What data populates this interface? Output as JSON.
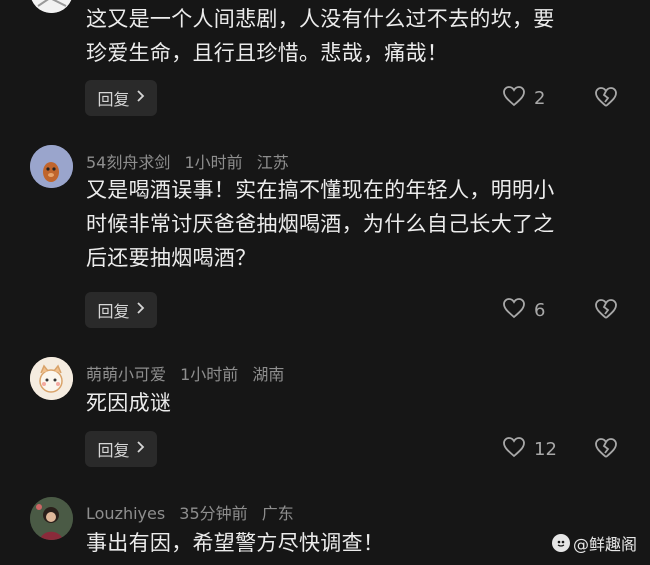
{
  "comments": [
    {
      "user": "",
      "time": "",
      "location": "",
      "text_lines": [
        "这又是一个人间悲剧，人没有什么过不去的坎，要",
        "珍爱生命，且行且珍惜。悲哉，痛哉！"
      ],
      "reply_label": "回复",
      "likes": "2"
    },
    {
      "user": "54刻舟求剑",
      "time": "1小时前",
      "location": "江苏",
      "text_lines": [
        "又是喝酒误事！实在搞不懂现在的年轻人，明明小",
        "时候非常讨厌爸爸抽烟喝酒，为什么自己长大了之",
        "后还要抽烟喝酒？"
      ],
      "reply_label": "回复",
      "likes": "6"
    },
    {
      "user": "萌萌小可爱",
      "time": "1小时前",
      "location": "湖南",
      "text_lines": [
        "死因成谜"
      ],
      "reply_label": "回复",
      "likes": "12"
    },
    {
      "user": "Louzhiyes",
      "time": "35分钟前",
      "location": "广东",
      "text_lines": [
        "事出有因，希望警方尽快调查！"
      ]
    }
  ],
  "watermark": "@鲜趣阁",
  "colors": {
    "background": "#161616",
    "text": "#ececec",
    "meta": "#8e8e8e",
    "button": "#2a2a2a"
  },
  "icons": {
    "reply_chevron": "chevron-right-icon",
    "like": "heart-outline-icon",
    "dislike": "broken-heart-icon"
  }
}
